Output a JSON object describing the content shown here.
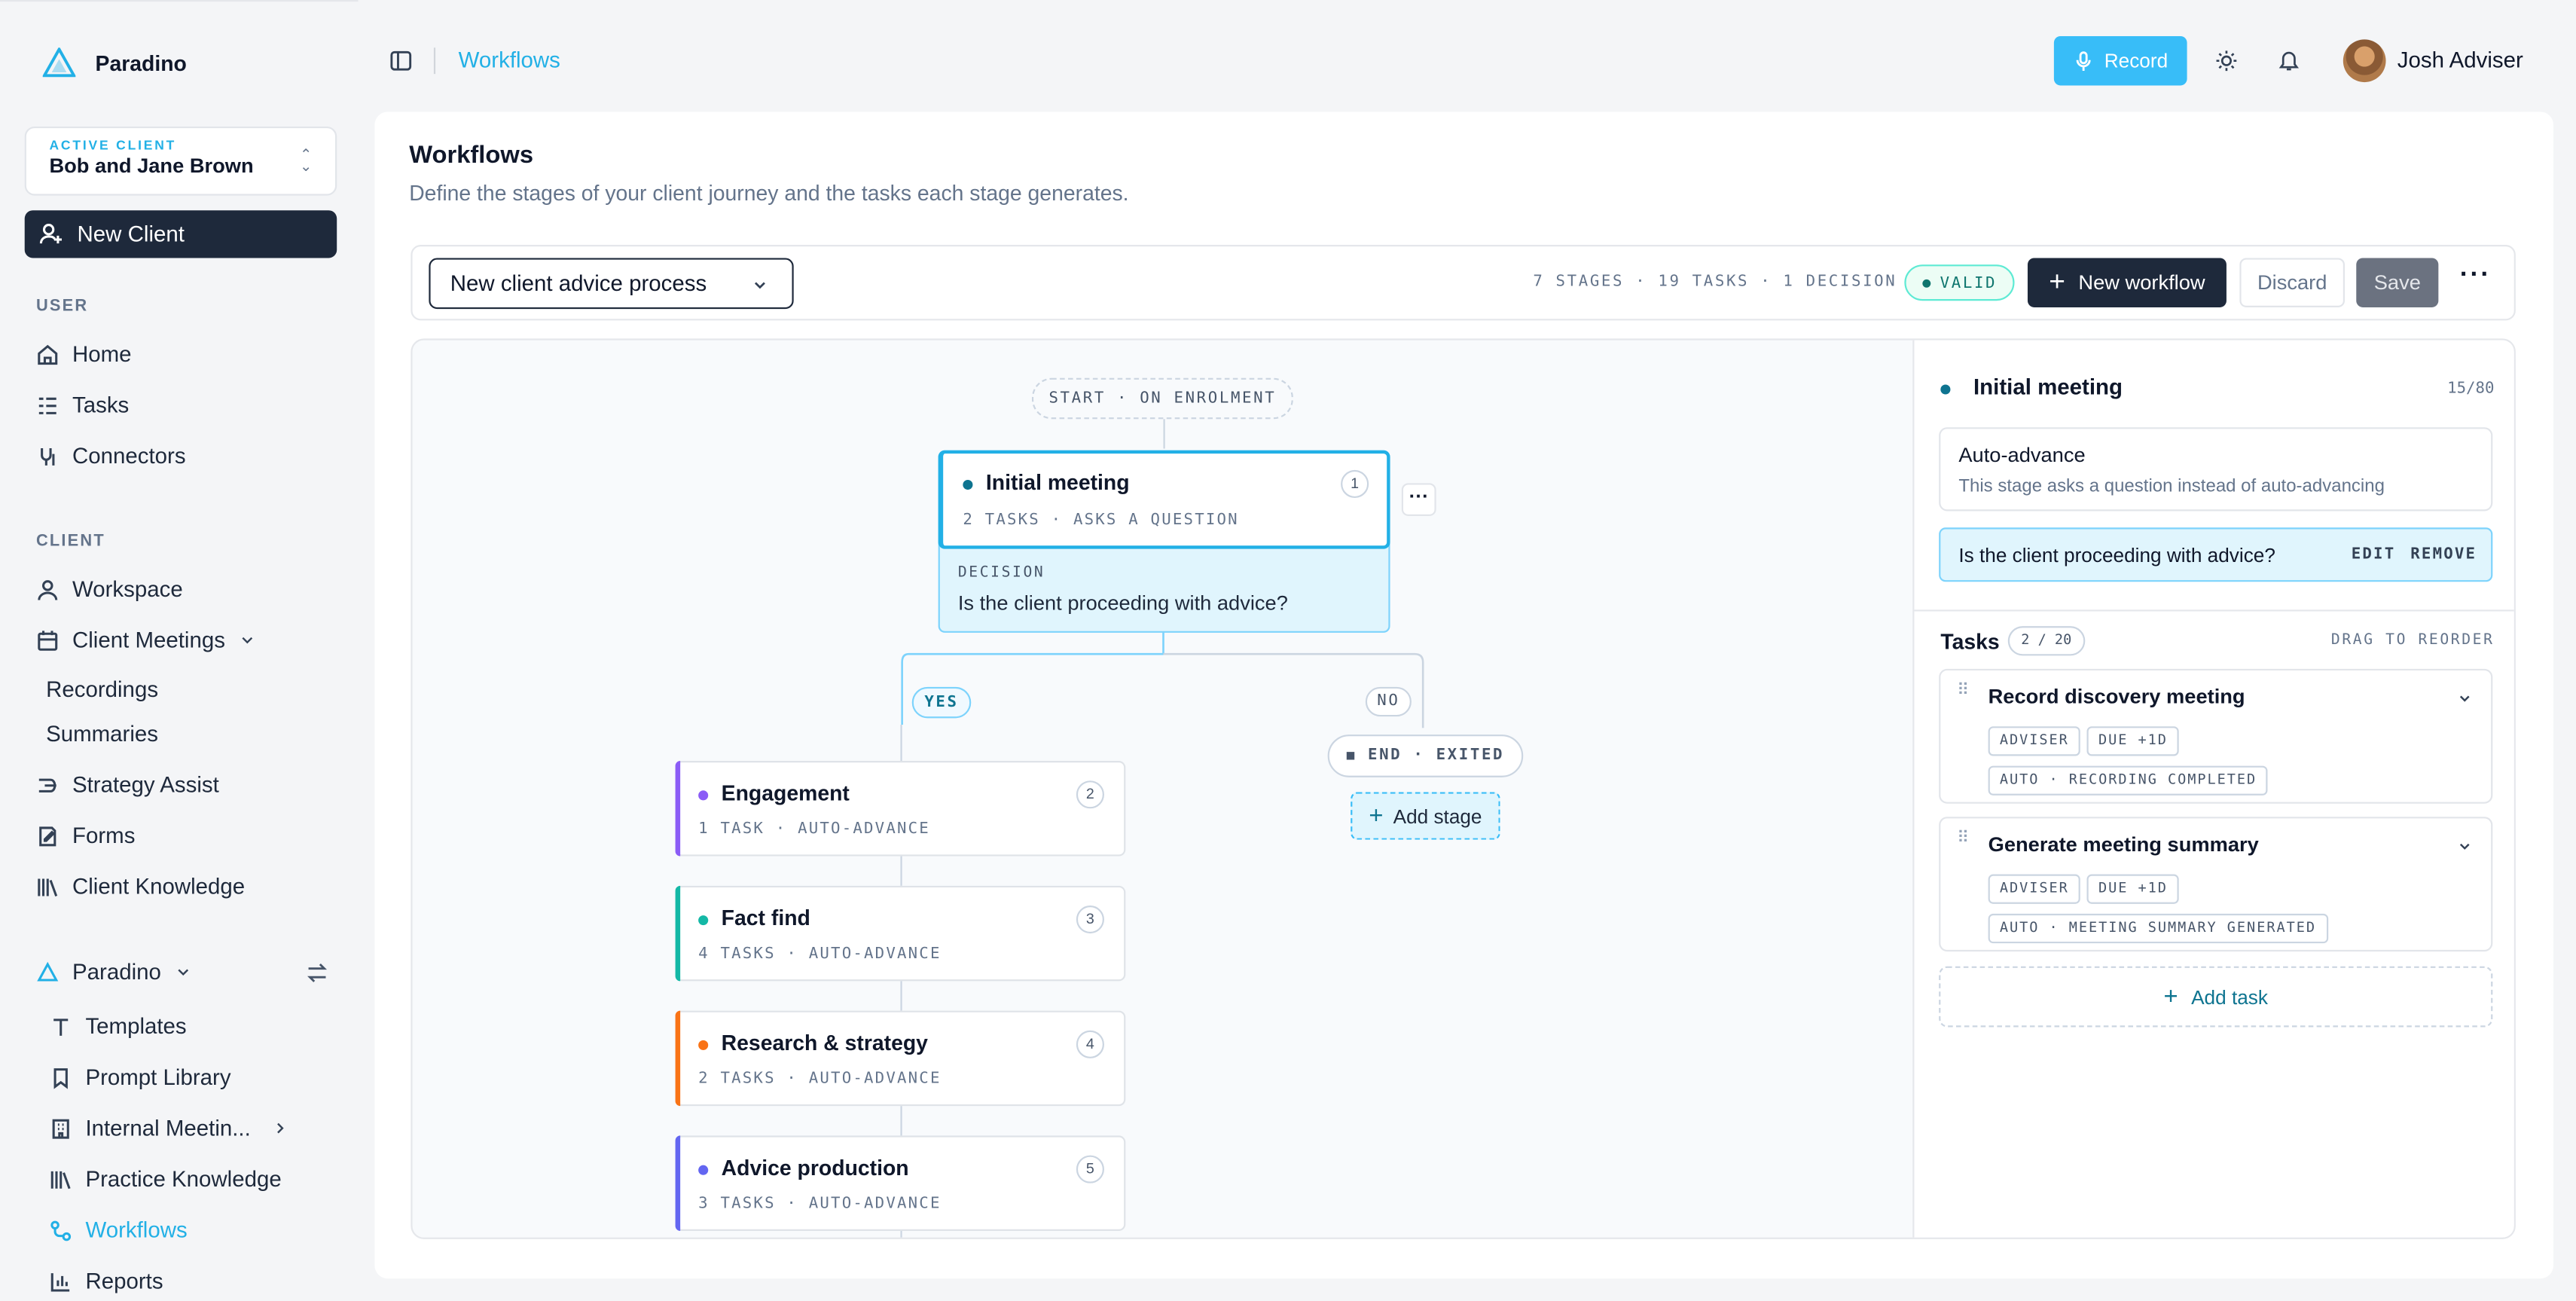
{
  "brand": {
    "name": "Paradino"
  },
  "active_client": {
    "label": "ACTIVE CLIENT",
    "name": "Bob and Jane Brown"
  },
  "new_client": "New Client",
  "sections": {
    "user": "USER",
    "client": "CLIENT"
  },
  "nav": {
    "home": "Home",
    "tasks": "Tasks",
    "connectors": "Connectors",
    "workspace": "Workspace",
    "client_meetings": "Client Meetings",
    "recordings": "Recordings",
    "summaries": "Summaries",
    "strategy_assist": "Strategy Assist",
    "forms": "Forms",
    "client_knowledge": "Client Knowledge",
    "org": "Paradino",
    "templates": "Templates",
    "prompt_library": "Prompt Library",
    "internal_meetings": "Internal Meetin...",
    "practice_knowledge": "Practice Knowledge",
    "workflows": "Workflows",
    "reports": "Reports"
  },
  "topbar": {
    "breadcrumb": "Workflows",
    "record": "Record",
    "user": "Josh Adviser"
  },
  "page": {
    "title": "Workflows",
    "subtitle": "Define the stages of your client journey and the tasks each stage generates."
  },
  "toolbar": {
    "workflow_select": "New client advice process",
    "stats": "7 STAGES · 19 TASKS · 1 DECISION",
    "valid": "VALID",
    "new_workflow": "New workflow",
    "discard": "Discard",
    "save": "Save"
  },
  "flow": {
    "start": "START · ON ENROLMENT",
    "initial": {
      "title": "Initial meeting",
      "meta": "2 TASKS · ASKS A QUESTION",
      "num": "1"
    },
    "decision": {
      "label": "DECISION",
      "question": "Is the client proceeding with advice?"
    },
    "yes": "YES",
    "no": "NO",
    "end": "END · EXITED",
    "add_stage": "Add stage",
    "stages": [
      {
        "title": "Engagement",
        "meta": "1 TASK · AUTO-ADVANCE",
        "num": "2",
        "color": "#8b5cf6"
      },
      {
        "title": "Fact find",
        "meta": "4 TASKS · AUTO-ADVANCE",
        "num": "3",
        "color": "#14b8a6"
      },
      {
        "title": "Research & strategy",
        "meta": "2 TASKS · AUTO-ADVANCE",
        "num": "4",
        "color": "#f97316"
      },
      {
        "title": "Advice production",
        "meta": "3 TASKS · AUTO-ADVANCE",
        "num": "5",
        "color": "#6366f1"
      }
    ]
  },
  "panel": {
    "title": "Initial meeting",
    "count": "15/80",
    "auto_title": "Auto-advance",
    "auto_desc": "This stage asks a question instead of auto-advancing",
    "question": "Is the client proceeding with advice?",
    "edit": "EDIT",
    "remove": "REMOVE",
    "tasks_label": "Tasks",
    "tasks_count": "2 / 20",
    "drag": "DRAG TO REORDER",
    "tasks": [
      {
        "title": "Record discovery meeting",
        "tags": [
          "ADVISER",
          "DUE +1D"
        ],
        "auto": "AUTO · RECORDING COMPLETED"
      },
      {
        "title": "Generate meeting summary",
        "tags": [
          "ADVISER",
          "DUE +1D"
        ],
        "auto": "AUTO · MEETING SUMMARY GENERATED"
      }
    ],
    "add_task": "Add task"
  },
  "colors": {
    "accent": "#22b0e6",
    "dark": "#1e293b",
    "initial_dot": "#0e7490"
  }
}
